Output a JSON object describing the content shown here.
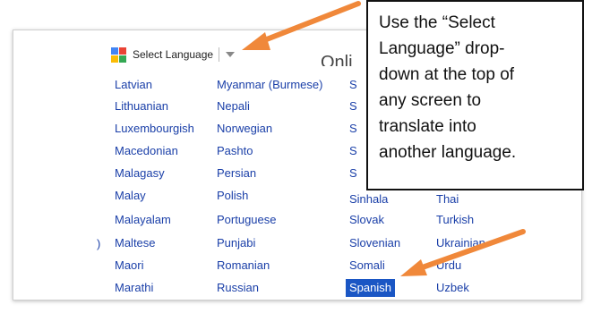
{
  "translate_bar": {
    "label": "Select Language"
  },
  "partial_heading": "Onli",
  "languages": {
    "col1": [
      "Latvian",
      "Lithuanian",
      "Luxembourgish",
      "Macedonian",
      "Malagasy",
      "Malay",
      "Malayalam",
      "Maltese",
      "Maori",
      "Marathi"
    ],
    "col2": [
      "Myanmar (Burmese)",
      "Nepali",
      "Norwegian",
      "Pashto",
      "Persian",
      "Polish",
      "Portuguese",
      "Punjabi",
      "Romanian",
      "Russian"
    ],
    "col3_visible": [
      "S",
      "S",
      "S",
      "S",
      "S",
      "Sinhala",
      "Slovak",
      "Slovenian",
      "Somali",
      "Spanish"
    ],
    "col4_visible": [
      "Thai",
      "Turkish",
      "Ukrainian",
      "Urdu",
      "Uzbek"
    ],
    "selected": "Spanish",
    "stray_char": ")"
  },
  "callout": {
    "lines": [
      "Use the “Select",
      "Language” drop-",
      "down at the top of",
      "any screen to",
      "translate into",
      "another language."
    ]
  },
  "colors": {
    "link": "#1a3fa8",
    "selected_bg": "#1a56c4",
    "arrow": "#f0883a"
  }
}
